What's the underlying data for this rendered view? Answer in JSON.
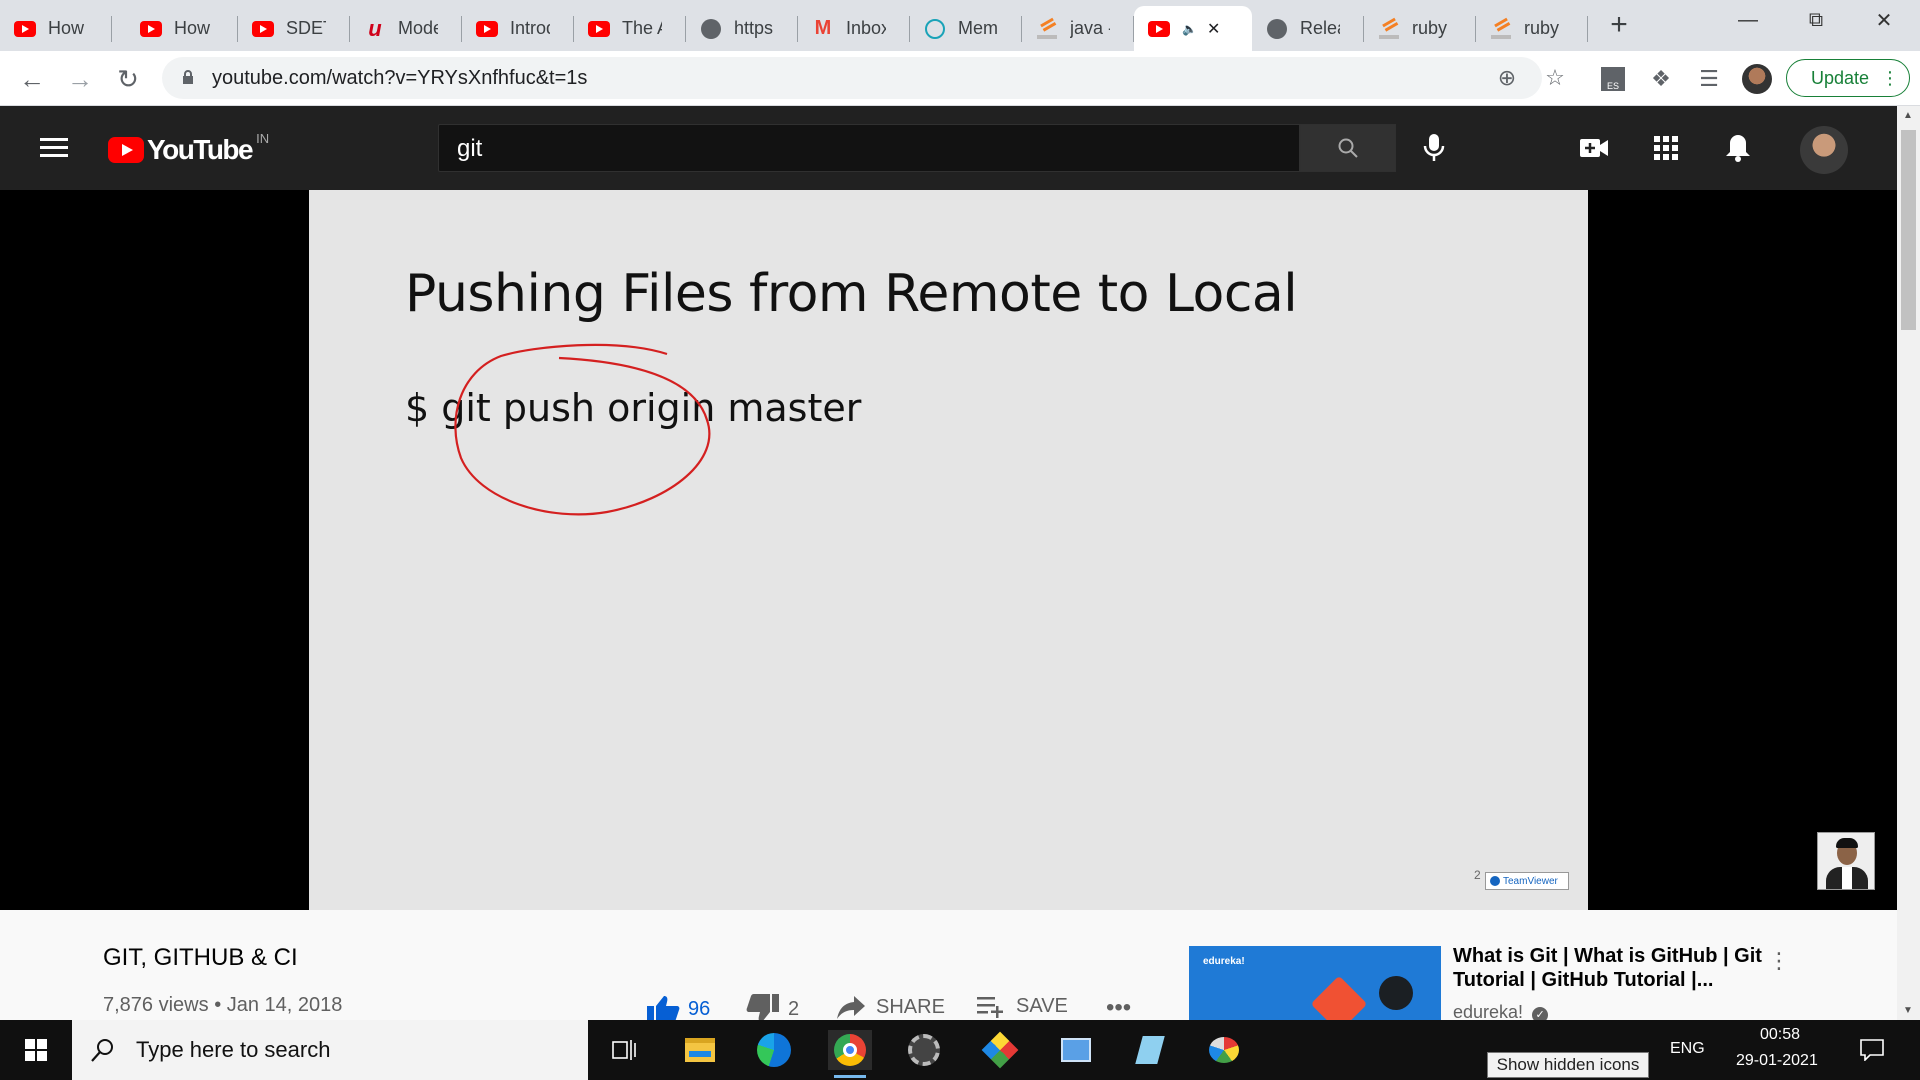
{
  "browser": {
    "tabs": [
      {
        "title": "How t",
        "icon": "youtube-icon"
      },
      {
        "title": "How T",
        "icon": "youtube-icon"
      },
      {
        "title": "SDET -",
        "icon": "youtube-icon"
      },
      {
        "title": "Moder",
        "icon": "udemy-icon"
      },
      {
        "title": "Introd",
        "icon": "youtube-icon"
      },
      {
        "title": "The Ar",
        "icon": "youtube-icon"
      },
      {
        "title": "https:/",
        "icon": "globe-icon"
      },
      {
        "title": "Inbox (",
        "icon": "gmail-icon"
      },
      {
        "title": "Memb",
        "icon": "site-icon"
      },
      {
        "title": "java - (",
        "icon": "stackoverflow-icon"
      },
      {
        "title": "",
        "icon": "youtube-icon",
        "active": true
      },
      {
        "title": "Releas",
        "icon": "globe-icon"
      },
      {
        "title": "ruby o",
        "icon": "stackoverflow-icon"
      },
      {
        "title": "ruby o",
        "icon": "stackoverflow-icon"
      }
    ],
    "url": "youtube.com/watch?v=YRYsXnfhfuc&t=1s",
    "update_label": "Update",
    "ext_badge": "ES"
  },
  "youtube": {
    "logo_text": "YouTube",
    "country_code": "IN",
    "search_query": "git"
  },
  "slide": {
    "title": "Pushing Files from Remote to Local",
    "command": "$ git push origin master",
    "watermark": "TeamViewer",
    "page_number": "2"
  },
  "video": {
    "title": "GIT, GITHUB & CI",
    "views": "7,876 views",
    "date": "Jan 14, 2018",
    "likes": "96",
    "dislikes": "2",
    "share_label": "SHARE",
    "save_label": "SAVE"
  },
  "recommended": {
    "title": "What is Git | What is GitHub | Git Tutorial | GitHub Tutorial |...",
    "channel": "edureka!",
    "thumb_brand": "edureka!"
  },
  "taskbar": {
    "search_placeholder": "Type here to search",
    "language": "ENG",
    "time": "00:58",
    "date": "29-01-2021",
    "tooltip": "Show hidden icons"
  },
  "colors": {
    "yt_red": "#ff0000",
    "yt_header": "#212121",
    "link_blue": "#065fd4",
    "update_green": "#188038",
    "annotation_red": "#d42020"
  }
}
